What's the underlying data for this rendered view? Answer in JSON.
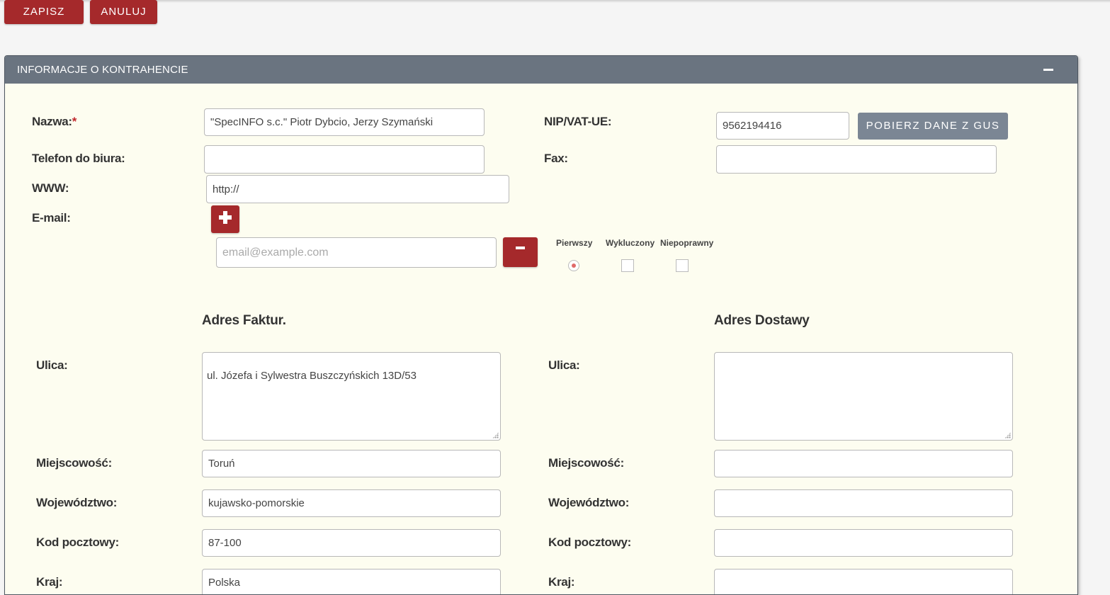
{
  "toolbar": {
    "save_label": "ZAPISZ",
    "cancel_label": "ANULUJ"
  },
  "panel": {
    "title": "INFORMACJE O KONTRAHENCIE"
  },
  "form": {
    "name_label": "Nazwa:",
    "name_required": "*",
    "name_value": "\"SpecINFO s.c.\" Piotr Dybcio, Jerzy Szymański",
    "nip_label": "NIP/VAT-UE:",
    "nip_value": "9562194416",
    "gus_button": "POBIERZ DANE Z GUS",
    "phone_label": "Telefon do biura:",
    "phone_value": "",
    "fax_label": "Fax:",
    "fax_value": "",
    "www_label": "WWW:",
    "www_value": "http://",
    "email_label": "E-mail:",
    "email_placeholder": "email@example.com",
    "email_options": {
      "primary": "Pierwszy",
      "excluded": "Wykluczony",
      "invalid": "Niepoprawny"
    }
  },
  "billing": {
    "title": "Adres Faktur.",
    "street_label": "Ulica:",
    "street_value": "ul. Józefa i Sylwestra Buszczyńskich 13D/53",
    "city_label": "Miejscowość:",
    "city_value": "Toruń",
    "region_label": "Województwo:",
    "region_value": "kujawsko-pomorskie",
    "postal_label": "Kod pocztowy:",
    "postal_value": "87-100",
    "country_label": "Kraj:",
    "country_value": "Polska"
  },
  "shipping": {
    "title": "Adres Dostawy",
    "street_label": "Ulica:",
    "street_value": "",
    "city_label": "Miejscowość:",
    "city_value": "",
    "region_label": "Województwo:",
    "region_value": "",
    "postal_label": "Kod pocztowy:",
    "postal_value": "",
    "country_label": "Kraj:",
    "country_value": ""
  },
  "colors": {
    "accent": "#a5292b",
    "panel_header": "#6a7480",
    "panel_bg": "#fdfdf0"
  }
}
